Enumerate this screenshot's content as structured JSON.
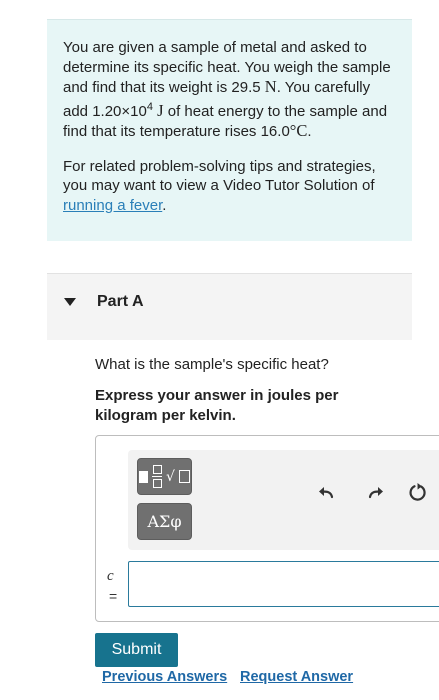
{
  "problem": {
    "intro": "You are given a sample of metal and asked to determine its specific heat. You weigh the sample and find that its weight is 29.5",
    "weight_unit": "N",
    "mid": ". You carefully add 1.20×10",
    "exponent": "4",
    "energy_unit": "J",
    "after_energy": "of heat energy to the sample and find that its temperature rises 16.0",
    "temp_unit": "°C",
    "end": ".",
    "tips_text": "For related problem-solving tips and strategies, you may want to view a Video Tutor Solution of",
    "tips_link": "running a fever",
    "tips_end": "."
  },
  "part": {
    "title": "Part A"
  },
  "question": {
    "prompt": "What is the sample's specific heat?",
    "instruction": "Express your answer in joules per kilogram per kelvin."
  },
  "answer": {
    "templates_icon": "templates-icon",
    "symbols_label": "ΑΣφ",
    "variable": "c",
    "equals": "=",
    "value": ""
  },
  "actions": {
    "submit_label": "Submit",
    "previous_answers_label": "Previous Answers",
    "request_answer_label": "Request Answer"
  },
  "colors": {
    "problem_bg": "#e7f6f6",
    "submit_bg": "#17738e",
    "link": "#1f68a6",
    "input_border": "#2a7a9c"
  }
}
